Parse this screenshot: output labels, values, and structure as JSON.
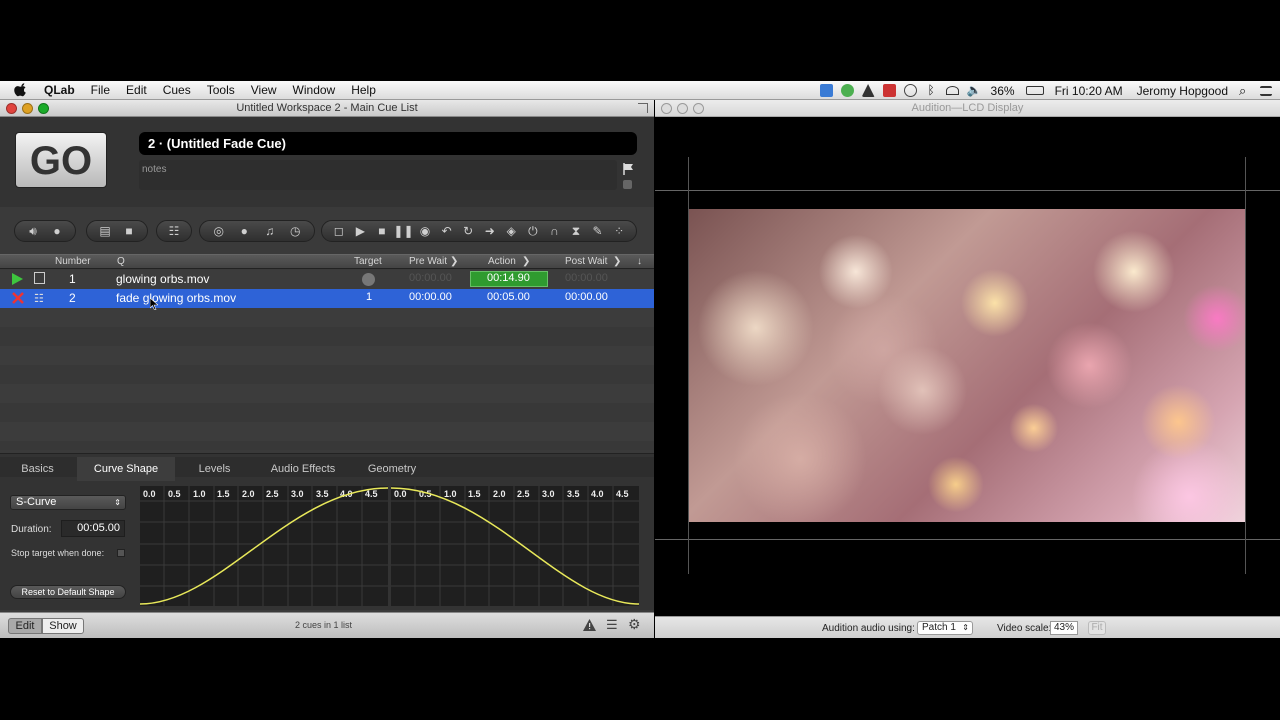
{
  "menubar": {
    "app": "QLab",
    "menus": [
      "File",
      "Edit",
      "Cues",
      "Tools",
      "View",
      "Window",
      "Help"
    ],
    "battery": "36%",
    "clock": "Fri 10:20 AM",
    "user": "Jeromy Hopgood"
  },
  "cue_window": {
    "title": "Untitled Workspace 2 - Main Cue List",
    "go_label": "GO",
    "cue_title": "2 · (Untitled Fade Cue)",
    "notes_placeholder": "notes",
    "columns": {
      "number": "Number",
      "q": "Q",
      "target": "Target",
      "pre_wait": "Pre Wait",
      "action": "Action",
      "post_wait": "Post Wait"
    },
    "cues": [
      {
        "number": "1",
        "name": "glowing orbs.mov",
        "target": "",
        "pre_wait": "00:00.00",
        "action": "00:14.90",
        "post_wait": "00:00.00"
      },
      {
        "number": "2",
        "name": "fade glowing orbs.mov",
        "target": "1",
        "pre_wait": "00:00.00",
        "action": "00:05.00",
        "post_wait": "00:00.00"
      }
    ]
  },
  "inspector": {
    "tabs": [
      "Basics",
      "Curve Shape",
      "Levels",
      "Audio Effects",
      "Geometry"
    ],
    "active_tab": "Curve Shape",
    "curve_select": "S-Curve",
    "duration_label": "Duration:",
    "duration_value": "00:05.00",
    "stop_target_label": "Stop target when done:",
    "reset_button": "Reset to Default Shape",
    "ticks": [
      "0.0",
      "0.5",
      "1.0",
      "1.5",
      "2.0",
      "2.5",
      "3.0",
      "3.5",
      "4.0",
      "4.5"
    ]
  },
  "statusbar": {
    "edit": "Edit",
    "show": "Show",
    "summary": "2 cues in 1 list"
  },
  "audition_window": {
    "title": "Audition—LCD Display",
    "audio_label": "Audition audio using:",
    "audio_patch": "Patch 1",
    "video_scale_label": "Video scale:",
    "video_scale_value": "43%",
    "fit_button": "Fit"
  },
  "colors": {
    "selection": "#2e63d7",
    "accent_green": "#2f9b2f",
    "curve_yellow": "#e8e85a"
  }
}
